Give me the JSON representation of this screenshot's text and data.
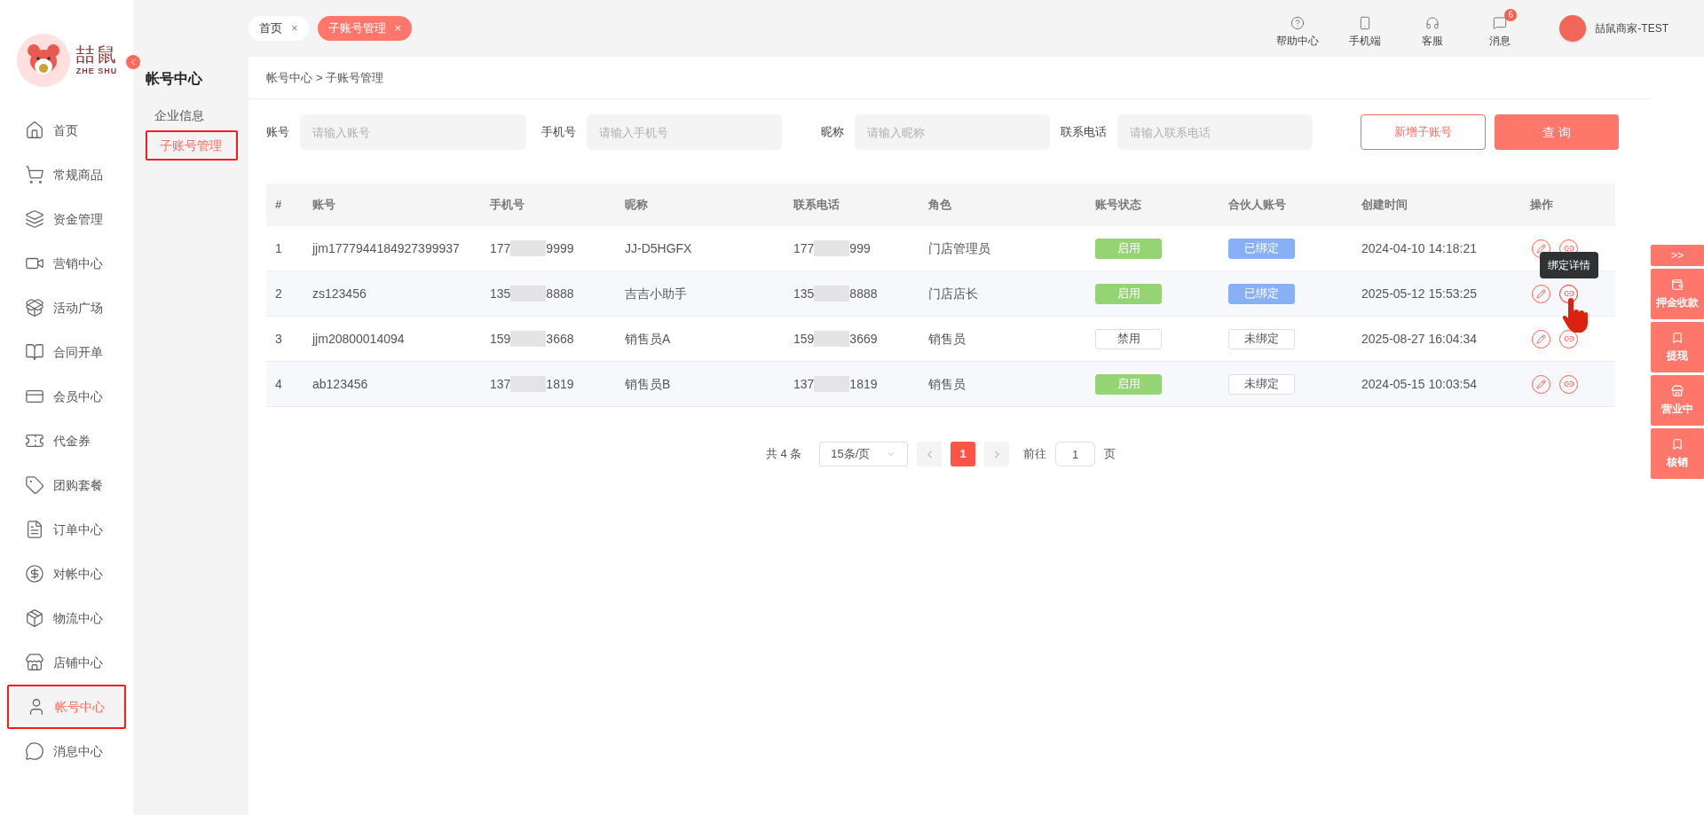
{
  "logo": {
    "name": "喆鼠",
    "subtitle": "ZHE SHU"
  },
  "sidebar": {
    "items": [
      {
        "label": "首页",
        "selected": false
      },
      {
        "label": "常规商品",
        "selected": false
      },
      {
        "label": "资金管理",
        "selected": false
      },
      {
        "label": "营销中心",
        "selected": false
      },
      {
        "label": "活动广场",
        "selected": false
      },
      {
        "label": "合同开单",
        "selected": false
      },
      {
        "label": "会员中心",
        "selected": false
      },
      {
        "label": "代金券",
        "selected": false
      },
      {
        "label": "团购套餐",
        "selected": false
      },
      {
        "label": "订单中心",
        "selected": false
      },
      {
        "label": "对帐中心",
        "selected": false
      },
      {
        "label": "物流中心",
        "selected": false
      },
      {
        "label": "店铺中心",
        "selected": false
      },
      {
        "label": "帐号中心",
        "selected": true
      },
      {
        "label": "消息中心",
        "selected": false
      }
    ]
  },
  "submenu": {
    "title": "帐号中心",
    "items": [
      {
        "label": "企业信息",
        "selected": false
      },
      {
        "label": "子账号管理",
        "selected": true
      }
    ]
  },
  "tabs": [
    {
      "label": "首页",
      "close": "×",
      "selected": false
    },
    {
      "label": "子账号管理",
      "close": "×",
      "selected": true
    }
  ],
  "topbar": {
    "items": [
      {
        "label": "帮助中心"
      },
      {
        "label": "手机端"
      },
      {
        "label": "客服"
      },
      {
        "label": "消息",
        "badge": "6"
      }
    ],
    "user": "喆鼠商家-TEST"
  },
  "breadcrumb": [
    "帐号中心",
    "> 子账号管理"
  ],
  "filters": [
    {
      "label": "账号",
      "placeholder": "请输入账号"
    },
    {
      "label": "手机号",
      "placeholder": "请输入手机号"
    },
    {
      "label": "昵称",
      "placeholder": "请输入昵称"
    },
    {
      "label": "联系电话",
      "placeholder": "请输入联系电话"
    }
  ],
  "buttons": {
    "add": "新增子账号",
    "query": "查 询"
  },
  "table": {
    "columns": [
      "#",
      "账号",
      "手机号",
      "昵称",
      "联系电话",
      "角色",
      "账号状态",
      "合伙人账号",
      "创建时间",
      "操作"
    ],
    "rows": [
      {
        "index": "1",
        "account": "jjm1777944184927399937",
        "phone": [
          "177",
          "9999"
        ],
        "nickname": "JJ-D5HGFX",
        "contact": [
          "177",
          "999"
        ],
        "role": "门店管理员",
        "status": {
          "label": "启用",
          "kind": "enabled"
        },
        "partner": {
          "label": "已绑定",
          "kind": "bound"
        },
        "created": "2024-04-10 14:18:21"
      },
      {
        "index": "2",
        "account": "zs123456",
        "phone": [
          "135",
          "8888"
        ],
        "nickname": "吉吉小助手",
        "contact": [
          "135",
          "8888"
        ],
        "role": "门店店长",
        "status": {
          "label": "启用",
          "kind": "enabled"
        },
        "partner": {
          "label": "已绑定",
          "kind": "bound"
        },
        "created": "2025-05-12 15:53:25",
        "tooltip": "绑定详情"
      },
      {
        "index": "3",
        "account": "jjm20800014094",
        "phone": [
          "159",
          "3668"
        ],
        "nickname": "销售员A",
        "contact": [
          "159",
          "3669"
        ],
        "role": "销售员",
        "status": {
          "label": "禁用",
          "kind": "disabled"
        },
        "partner": {
          "label": "未绑定",
          "kind": "unbound"
        },
        "created": "2025-08-27 16:04:34"
      },
      {
        "index": "4",
        "account": "ab123456",
        "phone": [
          "137",
          "1819"
        ],
        "nickname": "销售员B",
        "contact": [
          "137",
          "1819"
        ],
        "role": "销售员",
        "status": {
          "label": "启用",
          "kind": "enabled"
        },
        "partner": {
          "label": "未绑定",
          "kind": "unbound"
        },
        "created": "2024-05-15 10:03:54"
      }
    ]
  },
  "pagination": {
    "total": "共 4 条",
    "page_size": "15条/页",
    "pages": [
      {
        "label": "1",
        "selected": true
      }
    ],
    "goto_label": "前往",
    "goto_value": "1",
    "goto_suffix": "页"
  },
  "float_panel": {
    "toggle": ">>",
    "items": [
      {
        "label": "押金收款"
      },
      {
        "label": "提现"
      },
      {
        "label": "营业中"
      },
      {
        "label": "核销"
      }
    ]
  }
}
